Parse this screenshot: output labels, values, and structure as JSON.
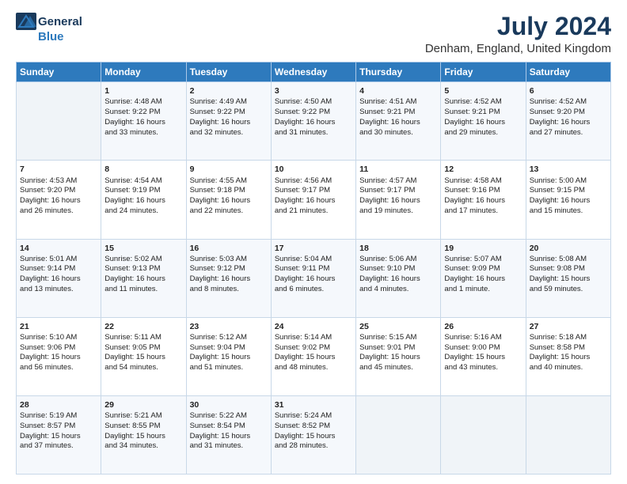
{
  "header": {
    "logo_general": "General",
    "logo_blue": "Blue",
    "title": "July 2024",
    "subtitle": "Denham, England, United Kingdom"
  },
  "columns": [
    "Sunday",
    "Monday",
    "Tuesday",
    "Wednesday",
    "Thursday",
    "Friday",
    "Saturday"
  ],
  "rows": [
    [
      {
        "day": "",
        "info": ""
      },
      {
        "day": "1",
        "info": "Sunrise: 4:48 AM\nSunset: 9:22 PM\nDaylight: 16 hours\nand 33 minutes."
      },
      {
        "day": "2",
        "info": "Sunrise: 4:49 AM\nSunset: 9:22 PM\nDaylight: 16 hours\nand 32 minutes."
      },
      {
        "day": "3",
        "info": "Sunrise: 4:50 AM\nSunset: 9:22 PM\nDaylight: 16 hours\nand 31 minutes."
      },
      {
        "day": "4",
        "info": "Sunrise: 4:51 AM\nSunset: 9:21 PM\nDaylight: 16 hours\nand 30 minutes."
      },
      {
        "day": "5",
        "info": "Sunrise: 4:52 AM\nSunset: 9:21 PM\nDaylight: 16 hours\nand 29 minutes."
      },
      {
        "day": "6",
        "info": "Sunrise: 4:52 AM\nSunset: 9:20 PM\nDaylight: 16 hours\nand 27 minutes."
      }
    ],
    [
      {
        "day": "7",
        "info": "Sunrise: 4:53 AM\nSunset: 9:20 PM\nDaylight: 16 hours\nand 26 minutes."
      },
      {
        "day": "8",
        "info": "Sunrise: 4:54 AM\nSunset: 9:19 PM\nDaylight: 16 hours\nand 24 minutes."
      },
      {
        "day": "9",
        "info": "Sunrise: 4:55 AM\nSunset: 9:18 PM\nDaylight: 16 hours\nand 22 minutes."
      },
      {
        "day": "10",
        "info": "Sunrise: 4:56 AM\nSunset: 9:17 PM\nDaylight: 16 hours\nand 21 minutes."
      },
      {
        "day": "11",
        "info": "Sunrise: 4:57 AM\nSunset: 9:17 PM\nDaylight: 16 hours\nand 19 minutes."
      },
      {
        "day": "12",
        "info": "Sunrise: 4:58 AM\nSunset: 9:16 PM\nDaylight: 16 hours\nand 17 minutes."
      },
      {
        "day": "13",
        "info": "Sunrise: 5:00 AM\nSunset: 9:15 PM\nDaylight: 16 hours\nand 15 minutes."
      }
    ],
    [
      {
        "day": "14",
        "info": "Sunrise: 5:01 AM\nSunset: 9:14 PM\nDaylight: 16 hours\nand 13 minutes."
      },
      {
        "day": "15",
        "info": "Sunrise: 5:02 AM\nSunset: 9:13 PM\nDaylight: 16 hours\nand 11 minutes."
      },
      {
        "day": "16",
        "info": "Sunrise: 5:03 AM\nSunset: 9:12 PM\nDaylight: 16 hours\nand 8 minutes."
      },
      {
        "day": "17",
        "info": "Sunrise: 5:04 AM\nSunset: 9:11 PM\nDaylight: 16 hours\nand 6 minutes."
      },
      {
        "day": "18",
        "info": "Sunrise: 5:06 AM\nSunset: 9:10 PM\nDaylight: 16 hours\nand 4 minutes."
      },
      {
        "day": "19",
        "info": "Sunrise: 5:07 AM\nSunset: 9:09 PM\nDaylight: 16 hours\nand 1 minute."
      },
      {
        "day": "20",
        "info": "Sunrise: 5:08 AM\nSunset: 9:08 PM\nDaylight: 15 hours\nand 59 minutes."
      }
    ],
    [
      {
        "day": "21",
        "info": "Sunrise: 5:10 AM\nSunset: 9:06 PM\nDaylight: 15 hours\nand 56 minutes."
      },
      {
        "day": "22",
        "info": "Sunrise: 5:11 AM\nSunset: 9:05 PM\nDaylight: 15 hours\nand 54 minutes."
      },
      {
        "day": "23",
        "info": "Sunrise: 5:12 AM\nSunset: 9:04 PM\nDaylight: 15 hours\nand 51 minutes."
      },
      {
        "day": "24",
        "info": "Sunrise: 5:14 AM\nSunset: 9:02 PM\nDaylight: 15 hours\nand 48 minutes."
      },
      {
        "day": "25",
        "info": "Sunrise: 5:15 AM\nSunset: 9:01 PM\nDaylight: 15 hours\nand 45 minutes."
      },
      {
        "day": "26",
        "info": "Sunrise: 5:16 AM\nSunset: 9:00 PM\nDaylight: 15 hours\nand 43 minutes."
      },
      {
        "day": "27",
        "info": "Sunrise: 5:18 AM\nSunset: 8:58 PM\nDaylight: 15 hours\nand 40 minutes."
      }
    ],
    [
      {
        "day": "28",
        "info": "Sunrise: 5:19 AM\nSunset: 8:57 PM\nDaylight: 15 hours\nand 37 minutes."
      },
      {
        "day": "29",
        "info": "Sunrise: 5:21 AM\nSunset: 8:55 PM\nDaylight: 15 hours\nand 34 minutes."
      },
      {
        "day": "30",
        "info": "Sunrise: 5:22 AM\nSunset: 8:54 PM\nDaylight: 15 hours\nand 31 minutes."
      },
      {
        "day": "31",
        "info": "Sunrise: 5:24 AM\nSunset: 8:52 PM\nDaylight: 15 hours\nand 28 minutes."
      },
      {
        "day": "",
        "info": ""
      },
      {
        "day": "",
        "info": ""
      },
      {
        "day": "",
        "info": ""
      }
    ]
  ]
}
